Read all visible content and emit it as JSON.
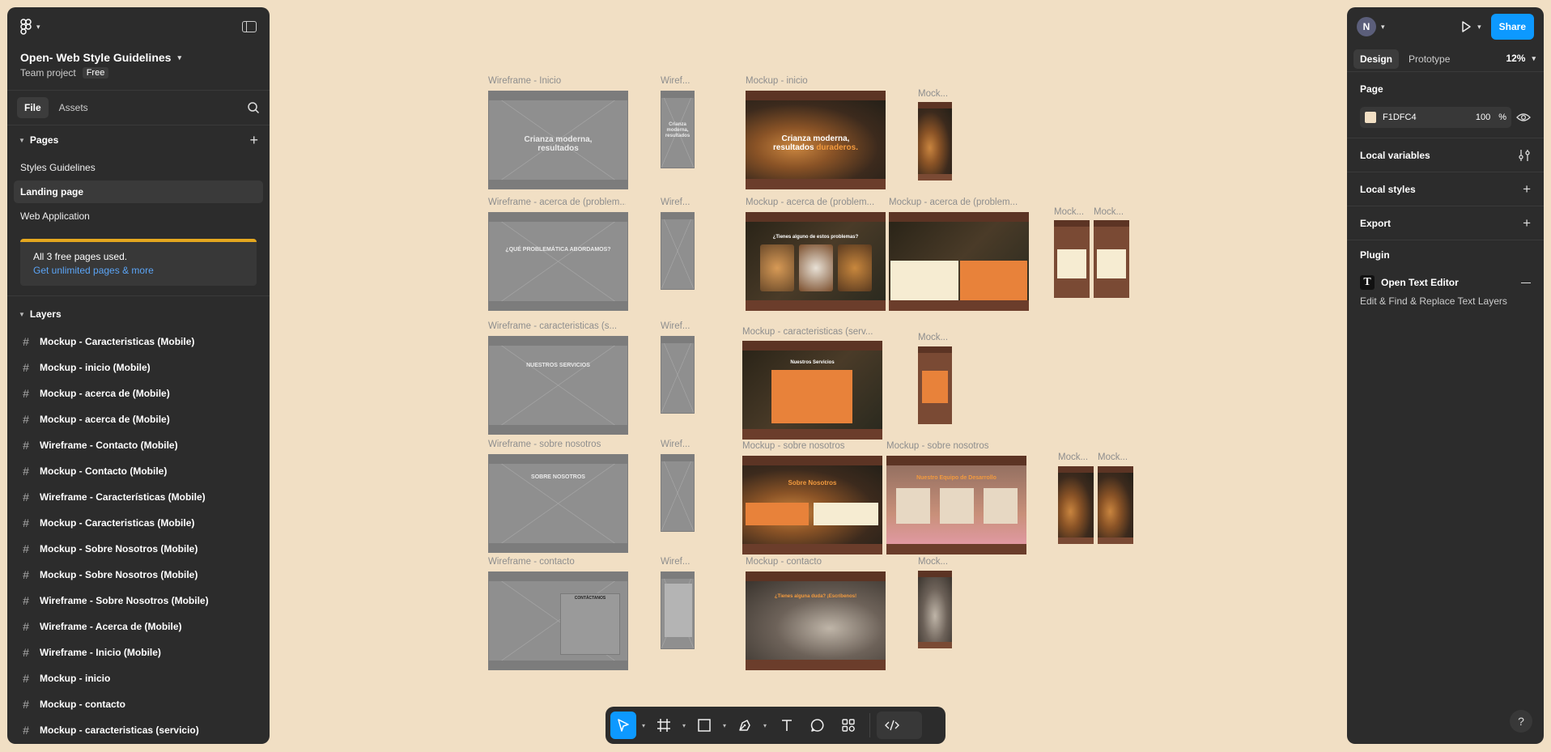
{
  "project": {
    "title": "Open- Web Style Guidelines",
    "subtitle": "Team project",
    "plan_badge": "Free"
  },
  "left_tabs": [
    "File",
    "Assets"
  ],
  "pages": {
    "heading": "Pages",
    "items": [
      "Styles Guidelines",
      "Landing page",
      "Web Application"
    ],
    "selected": "Landing page"
  },
  "upgrade": {
    "message": "All 3 free pages used.",
    "link": "Get unlimited pages & more"
  },
  "layers": {
    "heading": "Layers",
    "items": [
      "Mockup - Caracteristicas (Mobile)",
      "Mockup - inicio (Mobile)",
      "Mockup - acerca de (Mobile)",
      "Mockup - acerca de (Mobile)",
      "Wireframe - Contacto (Mobile)",
      "Mockup - Contacto (Mobile)",
      "Wireframe - Características (Mobile)",
      "Mockup - Caracteristicas (Mobile)",
      "Mockup - Sobre Nosotros (Mobile)",
      "Mockup - Sobre Nosotros (Mobile)",
      "Wireframe - Sobre Nosotros (Mobile)",
      "Wireframe - Acerca de (Mobile)",
      "Wireframe - Inicio (Mobile)",
      "Mockup - inicio",
      "Mockup - contacto",
      "Mockup - caracteristicas (servicio)"
    ]
  },
  "canvas": {
    "labels": {
      "wf_inicio": "Wireframe - Inicio",
      "wf_inicio_m": "Wiref...",
      "mk_inicio": "Mockup - inicio",
      "mk_inicio_m": "Mock...",
      "wf_acerca": "Wireframe - acerca de (problem...",
      "wf_acerca_m": "Wiref...",
      "mk_acerca": "Mockup - acerca de (problem...",
      "mk_acerca2": "Mockup - acerca de (problem...",
      "mk_acerca_m1": "Mock...",
      "mk_acerca_m2": "Mock...",
      "wf_caract": "Wireframe - caracteristicas (s...",
      "wf_caract_m": "Wiref...",
      "mk_caract": "Mockup - caracteristicas (serv...",
      "mk_caract_m": "Mock...",
      "wf_sobre": "Wireframe - sobre nosotros",
      "wf_sobre_m": "Wiref...",
      "mk_sobre": "Mockup - sobre nosotros",
      "mk_sobre2": "Mockup - sobre nosotros",
      "mk_sobre_m1": "Mock...",
      "mk_sobre_m2": "Mock...",
      "wf_contacto": "Wireframe - contacto",
      "wf_contacto_m": "Wiref...",
      "mk_contacto": "Mockup - contacto",
      "mk_contacto_m": "Mock..."
    },
    "frame_text": {
      "hero_line1": "Crianza moderna,",
      "hero_line2": "resultados",
      "hero_accent": "duraderos.",
      "wf_problem": "¿QUÉ PROBLEMÁTICA ABORDAMOS?",
      "wf_services": "NUESTROS SERVICIOS",
      "wf_about": "SOBRE NOSOTROS",
      "wf_contact": "CONTÁCTANOS",
      "mk_problem": "¿Tienes alguno de estos problemas?",
      "mk_about": "Sobre Nosotros",
      "mk_team": "Nuestro Equipo de Desarrollo",
      "mk_services": "Nuestros Servicios",
      "mk_contact": "¿Tienes alguna duda? ¡Escríbenos!"
    }
  },
  "toolbar": {
    "tools": [
      "move-tool",
      "frame-tool",
      "shape-tool",
      "pen-tool",
      "text-tool",
      "comment-tool",
      "actions-tool",
      "dev-mode-toggle"
    ]
  },
  "right": {
    "avatar_initial": "N",
    "share_label": "Share",
    "tabs": [
      "Design",
      "Prototype"
    ],
    "zoom": "12%",
    "page_section": "Page",
    "page_color": "F1DFC4",
    "page_opacity": "100",
    "page_opacity_unit": "%",
    "local_variables": "Local variables",
    "local_styles": "Local styles",
    "export": "Export",
    "plugin_heading": "Plugin",
    "plugin_name": "Open Text Editor",
    "plugin_desc": "Edit & Find & Replace Text Layers",
    "help": "?"
  },
  "colors": {
    "accent": "#0D99FF",
    "canvas": "#F1DFC4",
    "panel": "#2C2C2C",
    "upgrade_bar": "#E4A71F",
    "link": "#5BA4F5"
  }
}
